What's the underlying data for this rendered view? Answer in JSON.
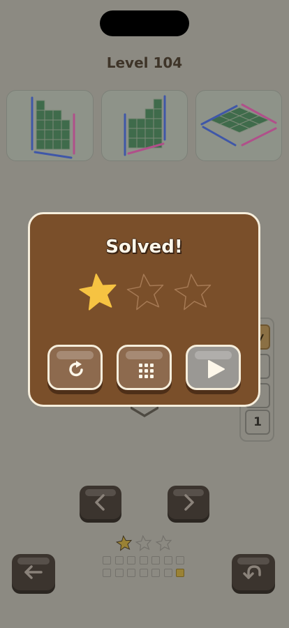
{
  "level": {
    "title": "Level 104"
  },
  "views": [
    {
      "name": "front-view"
    },
    {
      "name": "side-view"
    },
    {
      "name": "top-view"
    }
  ],
  "side_panel": {
    "count_value": "1"
  },
  "modal": {
    "title": "Solved!",
    "stars_earned": 1,
    "stars_total": 3,
    "buttons": [
      {
        "name": "restart",
        "icon": "restart-icon"
      },
      {
        "name": "level-select",
        "icon": "grid-icon"
      },
      {
        "name": "next",
        "icon": "play-icon"
      }
    ]
  },
  "progress": {
    "stars_earned": 1,
    "stars_total": 3,
    "level_dots_total": 14,
    "current_dot": 14
  },
  "colors": {
    "background": "#8c8a82",
    "modal_bg": "#7a4f2a",
    "modal_border": "#f6eedc",
    "star_gold": "#f6c342",
    "grid_green": "#3f6b4b",
    "edge_blue": "#3f57a8",
    "edge_pink": "#b0508a"
  }
}
